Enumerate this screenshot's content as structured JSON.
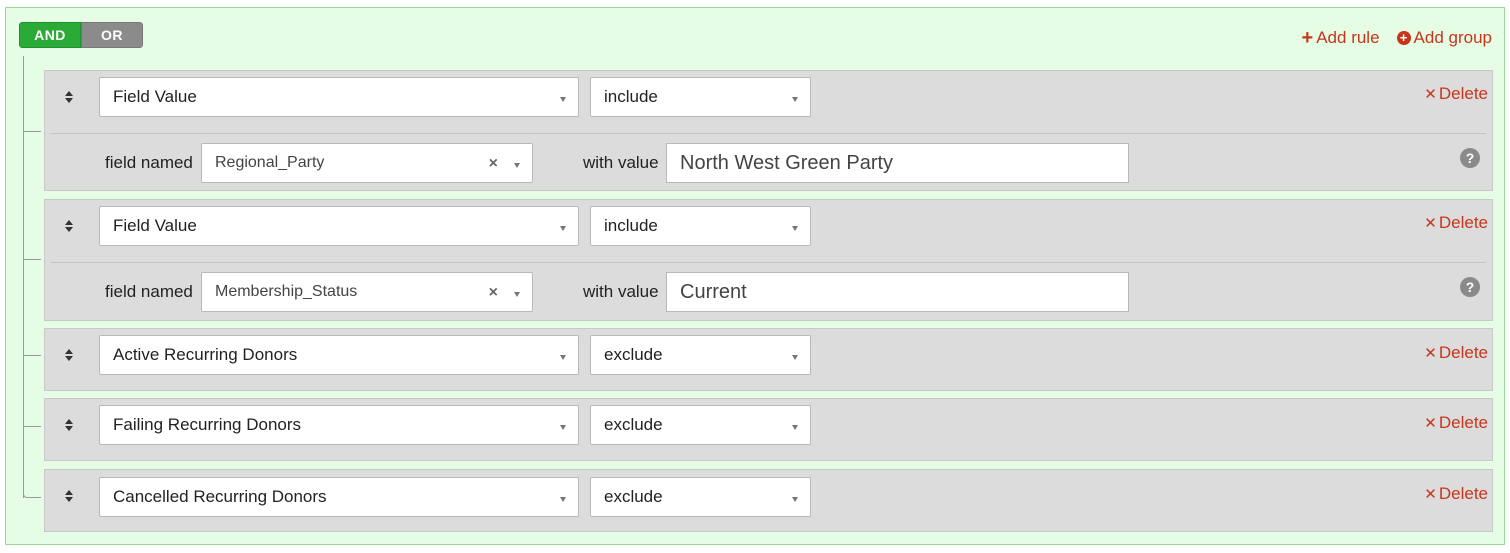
{
  "conjunction": {
    "and_label": "AND",
    "or_label": "OR"
  },
  "group_actions": {
    "add_rule": "Add rule",
    "add_group": "Add group"
  },
  "rules": [
    {
      "field": "Field Value",
      "operator": "include",
      "delete_label": "Delete",
      "sub": {
        "field_named_label": "field named",
        "field_name": "Regional_Party",
        "with_value_label": "with value",
        "value": "North West Green Party"
      }
    },
    {
      "field": "Field Value",
      "operator": "include",
      "delete_label": "Delete",
      "sub": {
        "field_named_label": "field named",
        "field_name": "Membership_Status",
        "with_value_label": "with value",
        "value": "Current"
      }
    },
    {
      "field": "Active Recurring Donors",
      "operator": "exclude",
      "delete_label": "Delete"
    },
    {
      "field": "Failing Recurring Donors",
      "operator": "exclude",
      "delete_label": "Delete"
    },
    {
      "field": "Cancelled Recurring Donors",
      "operator": "exclude",
      "delete_label": "Delete"
    }
  ],
  "colors": {
    "group_bg": "#e5fce5",
    "and_active": "#2aab37",
    "or_inactive": "#8b8b8b",
    "action_red": "#c7361c",
    "rule_bg": "#dcdcdc"
  }
}
